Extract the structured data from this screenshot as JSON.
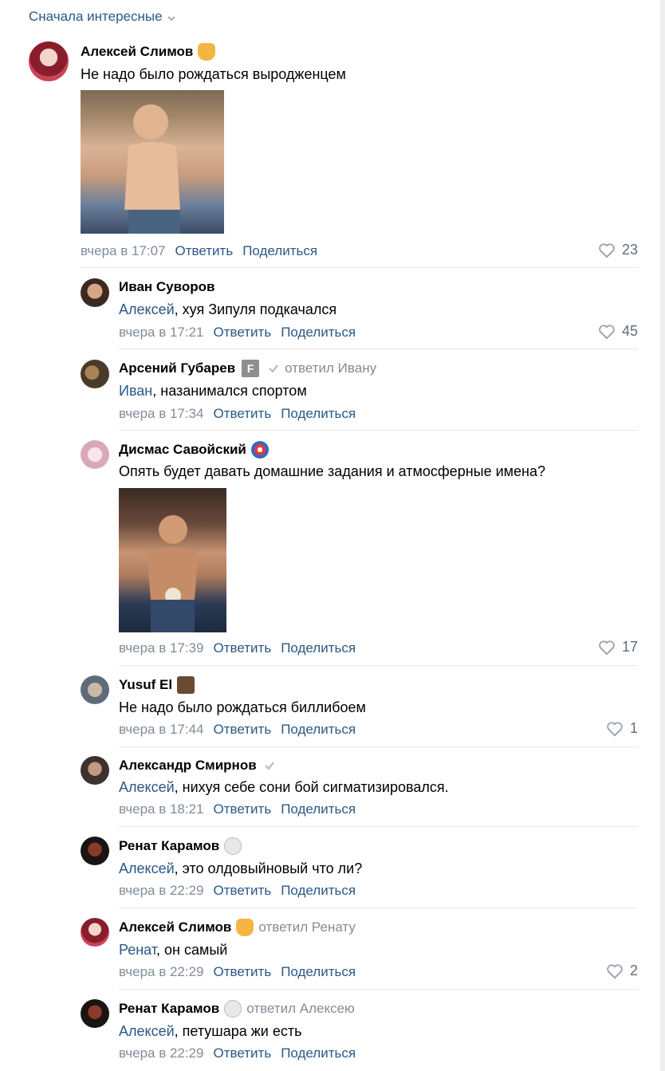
{
  "sort_label": "Сначала интересные",
  "comments": [
    {
      "author": "Алексей Слимов",
      "badge": "ghost-badge",
      "text_prefix": "",
      "mention": "",
      "text": "Не надо было рождаться выродженцем",
      "time": "вчера в 17:07",
      "reply": "Ответить",
      "share": "Поделиться",
      "likes": "23"
    },
    {
      "author": "Иван Суворов",
      "mention": "Алексей",
      "text": ", хуя Зипуля подкачался",
      "time": "вчера в 17:21",
      "reply": "Ответить",
      "share": "Поделиться",
      "likes": "45"
    },
    {
      "author": "Арсений Губарев",
      "badge_letter": "F",
      "reply_to": "ответил Ивану",
      "mention": "Иван",
      "text": ", назанимался спортом",
      "time": "вчера в 17:34",
      "reply": "Ответить",
      "share": "Поделиться"
    },
    {
      "author": "Дисмас Савойский",
      "text": "Опять будет давать домашние задания и атмосферные имена?",
      "time": "вчера в 17:39",
      "reply": "Ответить",
      "share": "Поделиться",
      "likes": "17"
    },
    {
      "author": "Yusuf El",
      "text": "Не надо было рождаться биллибоем",
      "time": "вчера в 17:44",
      "reply": "Ответить",
      "share": "Поделиться",
      "likes": "1"
    },
    {
      "author": "Александр Смирнов",
      "mention": "Алексей",
      "text": ", нихуя себе сони бой сигматизировался.",
      "time": "вчера в 18:21",
      "reply": "Ответить",
      "share": "Поделиться"
    },
    {
      "author": "Ренат Карамов",
      "mention": "Алексей",
      "text": ", это олдовыйновый что ли?",
      "time": "вчера в 22:29",
      "reply": "Ответить",
      "share": "Поделиться"
    },
    {
      "author": "Алексей Слимов",
      "reply_to": "ответил Ренату",
      "mention": "Ренат",
      "text": ", он самый",
      "time": "вчера в 22:29",
      "reply": "Ответить",
      "share": "Поделиться",
      "likes": "2"
    },
    {
      "author": "Ренат Карамов",
      "reply_to": "ответил Алексею",
      "mention": "Алексей",
      "text": ", петушара жи есть",
      "time": "вчера в 22:29",
      "reply": "Ответить",
      "share": "Поделиться"
    }
  ],
  "colors": {
    "link": "#2a5885",
    "muted": "#818c99",
    "separator": "#e7e8ec",
    "background": "#edeef0"
  }
}
